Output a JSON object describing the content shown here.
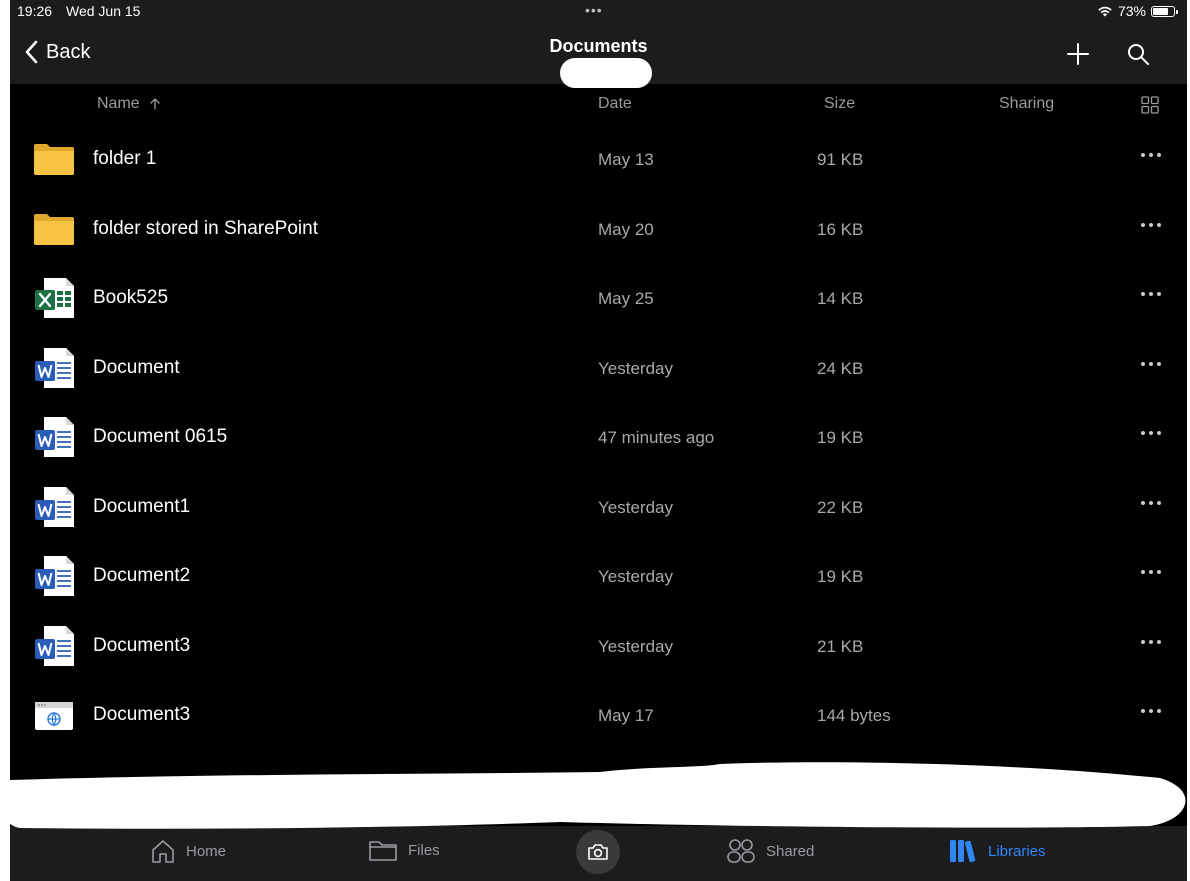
{
  "status_bar": {
    "time": "19:26",
    "date": "Wed Jun 15",
    "multitask_dots": "•••",
    "battery_percent": "73%",
    "battery_level": 0.73
  },
  "nav": {
    "back_label": "Back",
    "title": "Documents"
  },
  "columns": {
    "name": "Name",
    "date": "Date",
    "size": "Size",
    "sharing": "Sharing",
    "sort_icon": "arrow-up-icon"
  },
  "files": [
    {
      "name": "folder 1",
      "date": "May 13",
      "size": "91 KB",
      "type": "folder"
    },
    {
      "name": "folder stored in SharePoint",
      "date": "May 20",
      "size": "16 KB",
      "type": "folder"
    },
    {
      "name": "Book525",
      "date": "May 25",
      "size": "14 KB",
      "type": "excel"
    },
    {
      "name": "Document",
      "date": "Yesterday",
      "size": "24 KB",
      "type": "word"
    },
    {
      "name": "Document 0615",
      "date": "47 minutes ago",
      "size": "19 KB",
      "type": "word"
    },
    {
      "name": "Document1",
      "date": "Yesterday",
      "size": "22 KB",
      "type": "word"
    },
    {
      "name": "Document2",
      "date": "Yesterday",
      "size": "19 KB",
      "type": "word"
    },
    {
      "name": "Document3",
      "date": "Yesterday",
      "size": "21 KB",
      "type": "word"
    },
    {
      "name": "Document3",
      "date": "May 17",
      "size": "144 bytes",
      "type": "web"
    }
  ],
  "tab_bar": {
    "home": "Home",
    "files": "Files",
    "shared": "Shared",
    "libraries": "Libraries",
    "active": "libraries"
  },
  "colors": {
    "background": "#000000",
    "bar": "#1c1c1e",
    "accent": "#2f86f5",
    "folder": "#f6c343",
    "excel": "#1d7044",
    "word": "#2b5cb8",
    "secondary_text": "#a8a8ad"
  }
}
